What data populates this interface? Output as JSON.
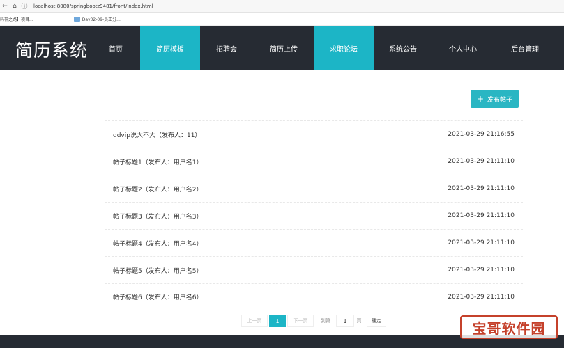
{
  "browser": {
    "back_icon": "arrow-left-icon",
    "home_icon": "home-icon",
    "url": "localhost:8080/springbootz9481/front/index.html",
    "bookmarks": [
      "码神之路】项目...",
      "Day02-09-员工分..."
    ]
  },
  "header": {
    "logo": "简历系统",
    "nav": [
      {
        "label": "首页",
        "active": false
      },
      {
        "label": "简历模板",
        "active": true
      },
      {
        "label": "招聘会",
        "active": false
      },
      {
        "label": "简历上传",
        "active": false
      },
      {
        "label": "求职论坛",
        "active": true
      },
      {
        "label": "系统公告",
        "active": false
      },
      {
        "label": "个人中心",
        "active": false
      },
      {
        "label": "后台管理",
        "active": false
      }
    ]
  },
  "main": {
    "post_button": {
      "icon": "plus-icon",
      "label": "发布帖子"
    },
    "posts": [
      {
        "title": "ddvip说大不大（发布人：11）",
        "date": "2021-03-29 21:16:55"
      },
      {
        "title": "帖子标题1（发布人：用户名1）",
        "date": "2021-03-29 21:11:10"
      },
      {
        "title": "帖子标题2（发布人：用户名2）",
        "date": "2021-03-29 21:11:10"
      },
      {
        "title": "帖子标题3（发布人：用户名3）",
        "date": "2021-03-29 21:11:10"
      },
      {
        "title": "帖子标题4（发布人：用户名4）",
        "date": "2021-03-29 21:11:10"
      },
      {
        "title": "帖子标题5（发布人：用户名5）",
        "date": "2021-03-29 21:11:10"
      },
      {
        "title": "帖子标题6（发布人：用户名6）",
        "date": "2021-03-29 21:11:10"
      }
    ]
  },
  "pagination": {
    "prev": "上一页",
    "current": "1",
    "next": "下一页",
    "goto_label": "到第",
    "page_input": "1",
    "page_suffix": "页",
    "confirm": "确定"
  },
  "watermark": {
    "text": "宝哥软件园"
  },
  "colors": {
    "header_bg": "#262b33",
    "accent": "#1cb5c6",
    "watermark": "#c5412b"
  }
}
